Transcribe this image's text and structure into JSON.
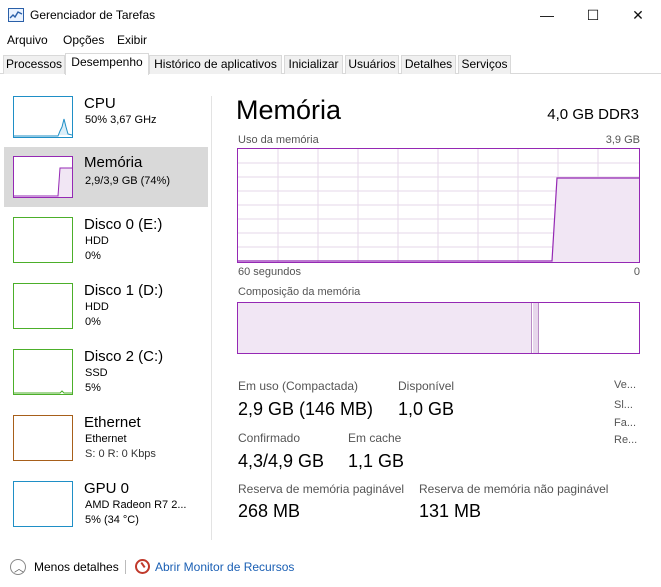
{
  "window": {
    "title": "Gerenciador de Tarefas",
    "minimize": "—",
    "maximize": "☐",
    "close": "✕"
  },
  "menu": [
    "Arquivo",
    "Opções",
    "Exibir"
  ],
  "tabs": [
    "Processos",
    "Desempenho",
    "Histórico de aplicativos",
    "Inicializar",
    "Usuários",
    "Detalhes",
    "Serviços"
  ],
  "active_tab": "Desempenho",
  "resources": [
    {
      "title": "CPU",
      "line1": "50% 3,67 GHz",
      "line2": "",
      "color": "#1f8fc6"
    },
    {
      "title": "Memória",
      "line1": "2,9/3,9 GB (74%)",
      "line2": "",
      "color": "#9528b4"
    },
    {
      "title": "Disco 0 (E:)",
      "line1": "HDD",
      "line2": "0%",
      "color": "#4caf2a"
    },
    {
      "title": "Disco 1 (D:)",
      "line1": "HDD",
      "line2": "0%",
      "color": "#4caf2a"
    },
    {
      "title": "Disco 2 (C:)",
      "line1": "SSD",
      "line2": "5%",
      "color": "#4caf2a"
    },
    {
      "title": "Ethernet",
      "line1": "Ethernet",
      "line2": "S: 0 R: 0 Kbps",
      "color": "#a75f1a"
    },
    {
      "title": "GPU 0",
      "line1": "AMD Radeon R7 2...",
      "line2": "5% (34 °C)",
      "color": "#1f8fc6"
    }
  ],
  "main": {
    "title": "Memória",
    "spec": "4,0 GB DDR3",
    "usage_label": "Uso da memória",
    "usage_max": "3,9 GB",
    "time_left": "60 segundos",
    "time_right": "0",
    "composition_label": "Composição da memória",
    "usage_fraction": 0.74
  },
  "stats": {
    "in_use_label": "Em uso (Compactada)",
    "in_use_value": "2,9 GB (146 MB)",
    "available_label": "Disponível",
    "available_value": "1,0 GB",
    "committed_label": "Confirmado",
    "committed_value": "4,3/4,9 GB",
    "cached_label": "Em cache",
    "cached_value": "1,1 GB",
    "paged_label": "Reserva de memória paginável",
    "paged_value": "268 MB",
    "nonpaged_label": "Reserva de memória não paginável",
    "nonpaged_value": "131 MB",
    "side": [
      "Ve...",
      "Sl...",
      "Fa...",
      "Re..."
    ]
  },
  "footer": {
    "fewer_details": "Menos detalhes",
    "resource_monitor": "Abrir Monitor de Recursos"
  }
}
